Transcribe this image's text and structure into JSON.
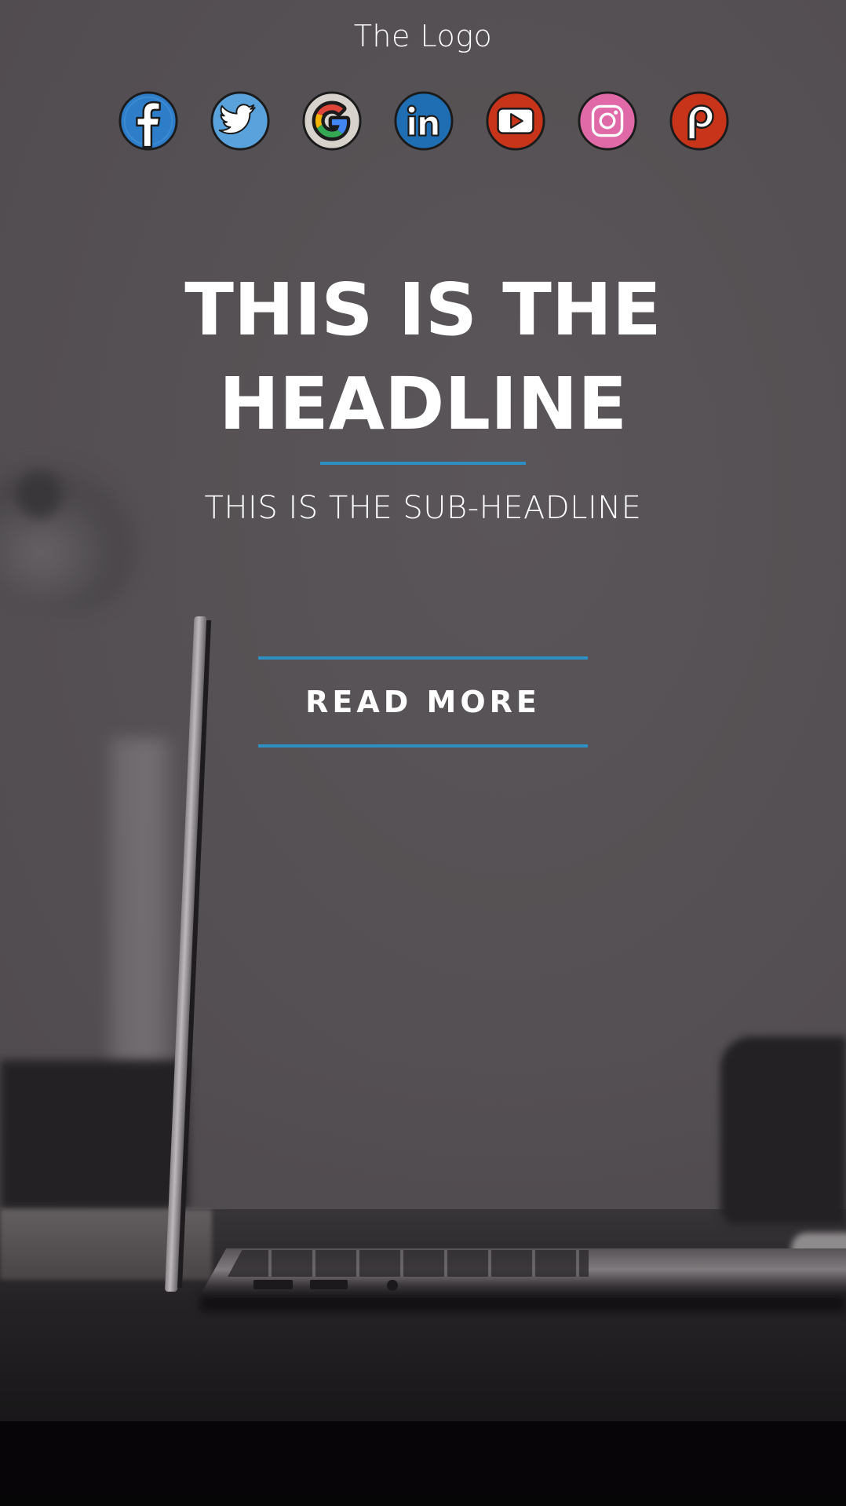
{
  "header": {
    "logo_text": "The Logo"
  },
  "social": [
    {
      "name": "facebook",
      "icon": "facebook-icon",
      "color": "#2d7dc8"
    },
    {
      "name": "twitter",
      "icon": "twitter-icon",
      "color": "#5aa2db"
    },
    {
      "name": "google",
      "icon": "google-icon",
      "color": "#d8d2cc"
    },
    {
      "name": "linkedin",
      "icon": "linkedin-icon",
      "color": "#1f6db3"
    },
    {
      "name": "youtube",
      "icon": "youtube-icon",
      "color": "#c8341a"
    },
    {
      "name": "instagram",
      "icon": "instagram-icon",
      "color": "#e06aa8"
    },
    {
      "name": "patreon",
      "icon": "patreon-icon",
      "color": "#c8341a"
    }
  ],
  "hero": {
    "headline_line1": "THIS IS THE",
    "headline_line2": "HEADLINE",
    "subheadline": "THIS IS THE SUB-HEADLINE",
    "cta_label": "READ MORE",
    "accent_color": "#2e8fc4"
  }
}
